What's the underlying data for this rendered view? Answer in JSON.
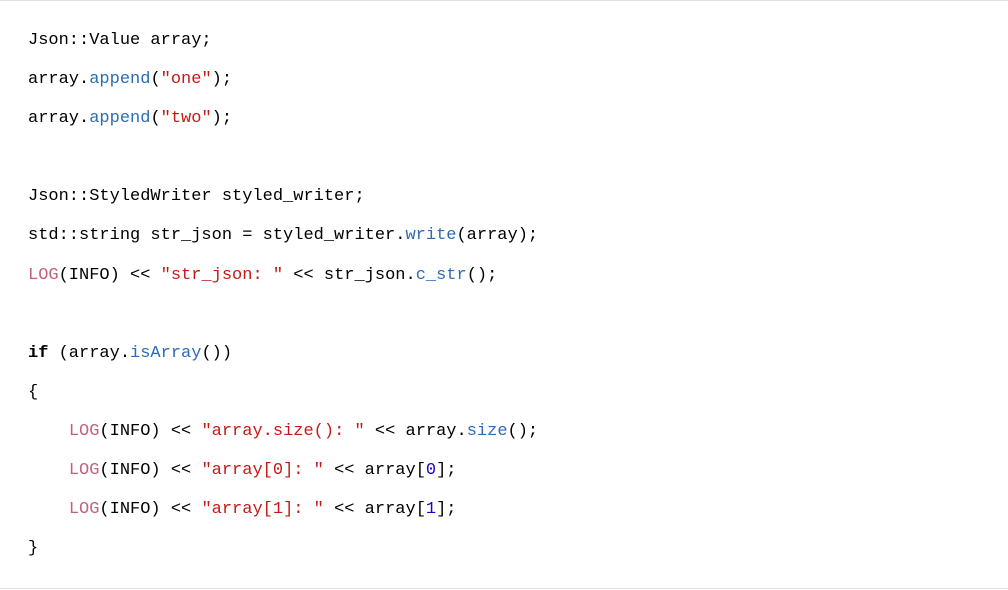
{
  "code": {
    "l1": {
      "a": "Json::Value array;"
    },
    "l2": {
      "a": "array.",
      "b": "append",
      "c": "(",
      "d": "\"one\"",
      "e": ");"
    },
    "l3": {
      "a": "array.",
      "b": "append",
      "c": "(",
      "d": "\"two\"",
      "e": ");"
    },
    "l4": {
      "a": ""
    },
    "l5": {
      "a": "Json::StyledWriter styled_writer;"
    },
    "l6": {
      "a": "std::string str_json = styled_writer.",
      "b": "write",
      "c": "(array);"
    },
    "l7": {
      "a": "LOG",
      "b": "(INFO) << ",
      "c": "\"str_json: \"",
      "d": " << str_json.",
      "e": "c_str",
      "f": "();"
    },
    "l8": {
      "a": ""
    },
    "l9": {
      "a": "if",
      "b": " (array.",
      "c": "isArray",
      "d": "())"
    },
    "l10": {
      "a": "{"
    },
    "l11": {
      "a": "    ",
      "b": "LOG",
      "c": "(INFO) << ",
      "d": "\"array.size(): \"",
      "e": " << array.",
      "f": "size",
      "g": "();"
    },
    "l12": {
      "a": "    ",
      "b": "LOG",
      "c": "(INFO) << ",
      "d": "\"array[0]: \"",
      "e": " << array[",
      "f": "0",
      "g": "];"
    },
    "l13": {
      "a": "    ",
      "b": "LOG",
      "c": "(INFO) << ",
      "d": "\"array[1]: \"",
      "e": " << array[",
      "f": "1",
      "g": "];"
    },
    "l14": {
      "a": "}"
    }
  }
}
